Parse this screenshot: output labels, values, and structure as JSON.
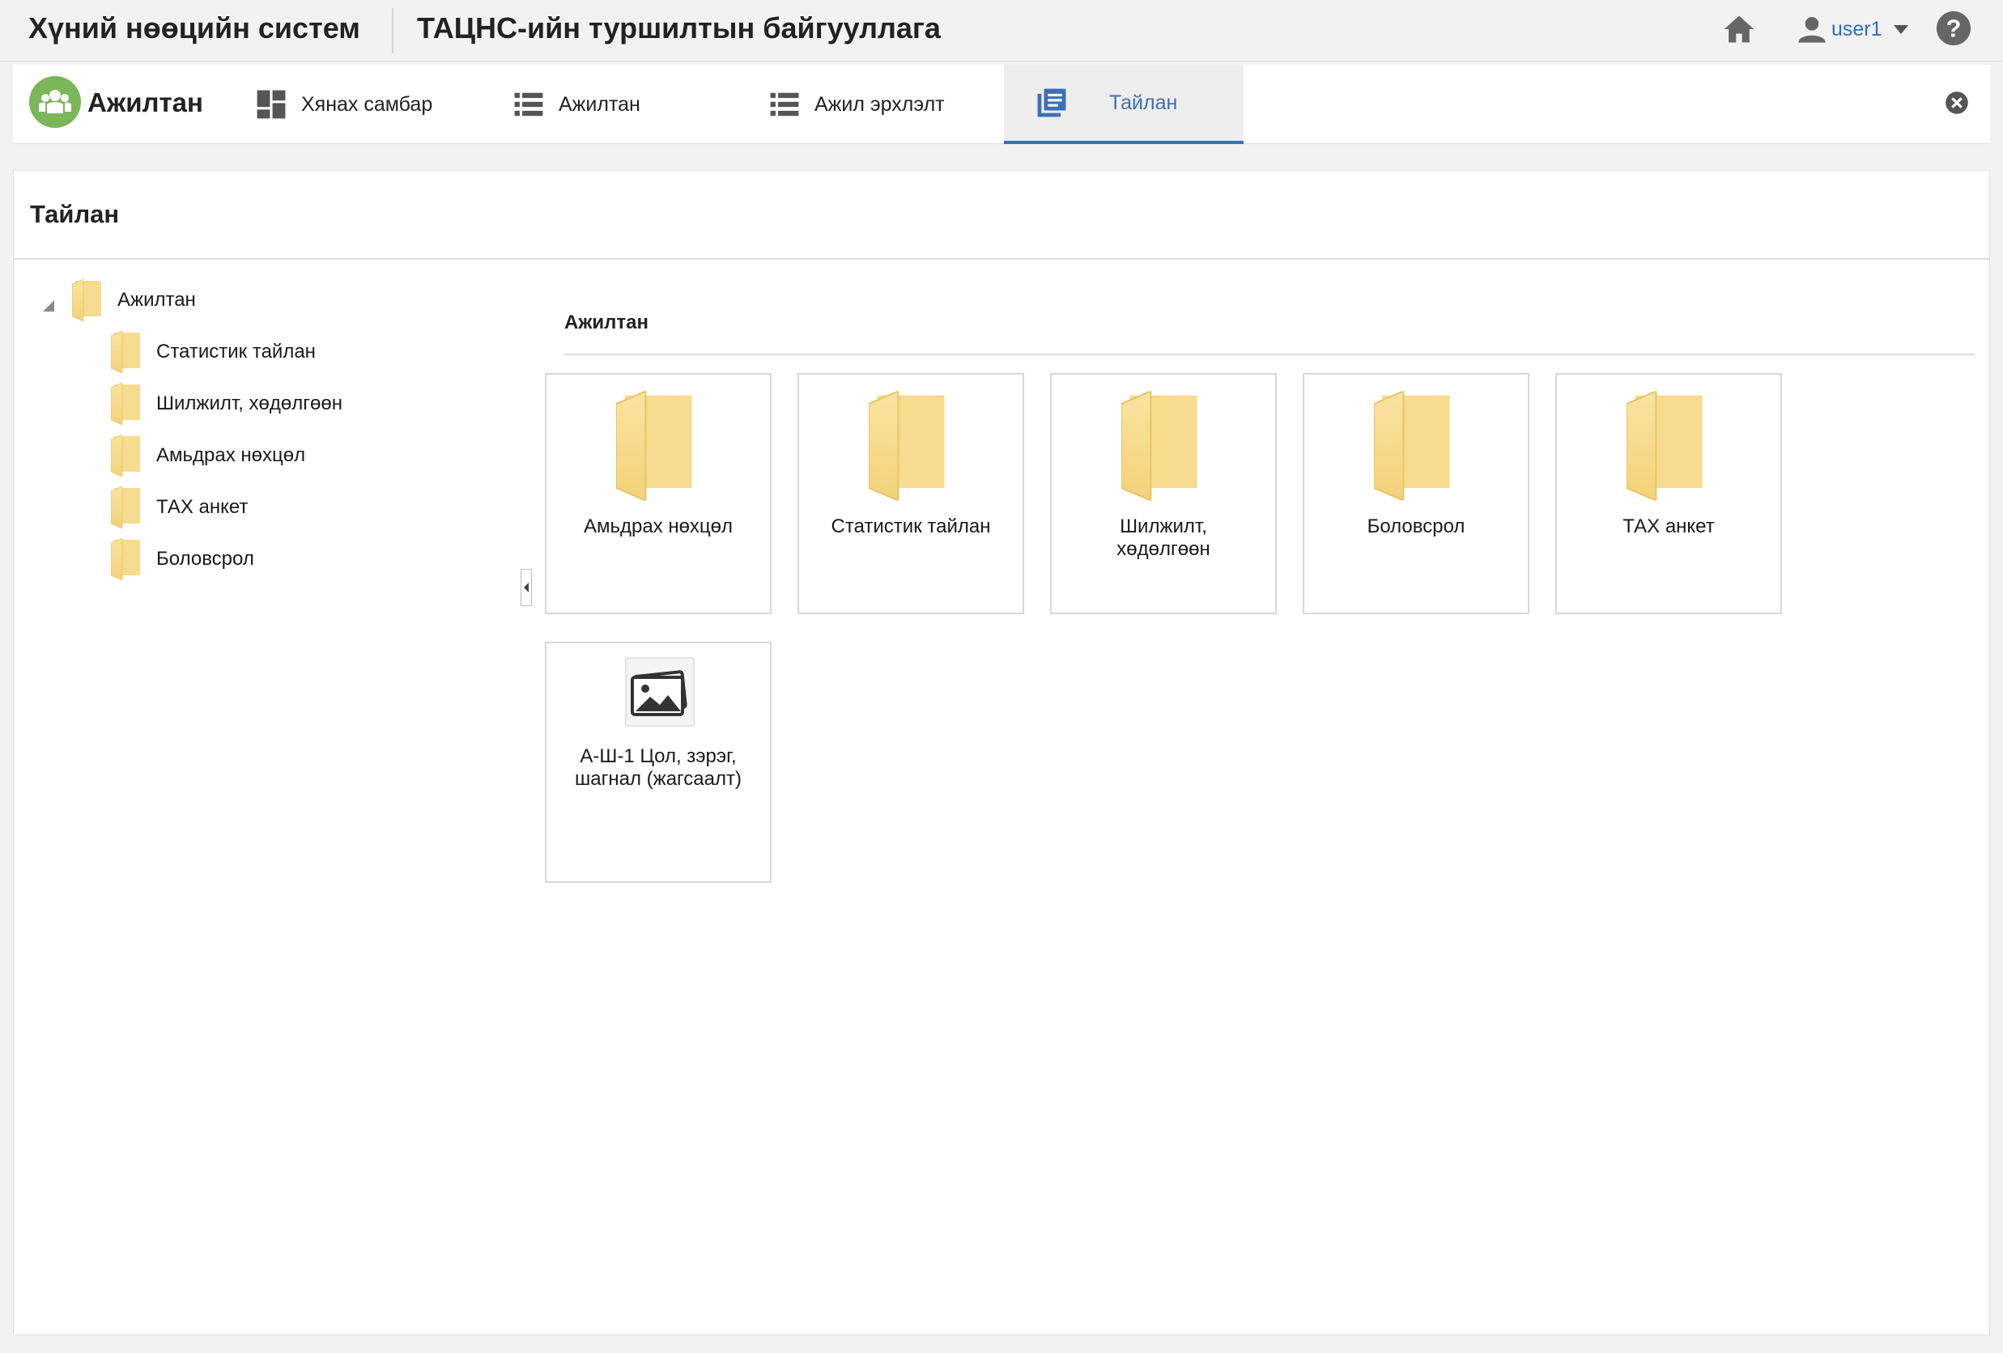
{
  "header": {
    "app_title": "Хүний нөөцийн систем",
    "org_title": "ТАЦНС-ийн туршилтын байгууллага",
    "user_name": "user1",
    "icons": [
      "home-icon",
      "user-icon",
      "chevron-down-icon",
      "help-icon"
    ]
  },
  "module": {
    "name": "Ажилтан",
    "tabs": [
      {
        "label": "Хянах самбар",
        "icon": "dashboard-icon"
      },
      {
        "label": "Ажилтан",
        "icon": "list-icon"
      },
      {
        "label": "Ажил эрхлэлт",
        "icon": "list-icon"
      },
      {
        "label": "Тайлан",
        "icon": "report-icon",
        "active": true
      }
    ],
    "accent_color": "#3d6fb6",
    "logo_color": "#7bb75a"
  },
  "page": {
    "title": "Тайлан"
  },
  "tree": {
    "root": "Ажилтан",
    "children": [
      "Статистик тайлан",
      "Шилжилт, хөдөлгөөн",
      "Амьдрах нөхцөл",
      "ТАХ анкет",
      "Боловсрол"
    ]
  },
  "content": {
    "section_title": "Ажилтан",
    "folders": [
      "Амьдрах нөхцөл",
      "Статистик тайлан",
      "Шилжилт, хөдөлгөөн",
      "Боловсрол",
      "ТАХ анкет"
    ],
    "report": "А-Ш-1 Цол, зэрэг, шагнал (жагсаалт)"
  }
}
